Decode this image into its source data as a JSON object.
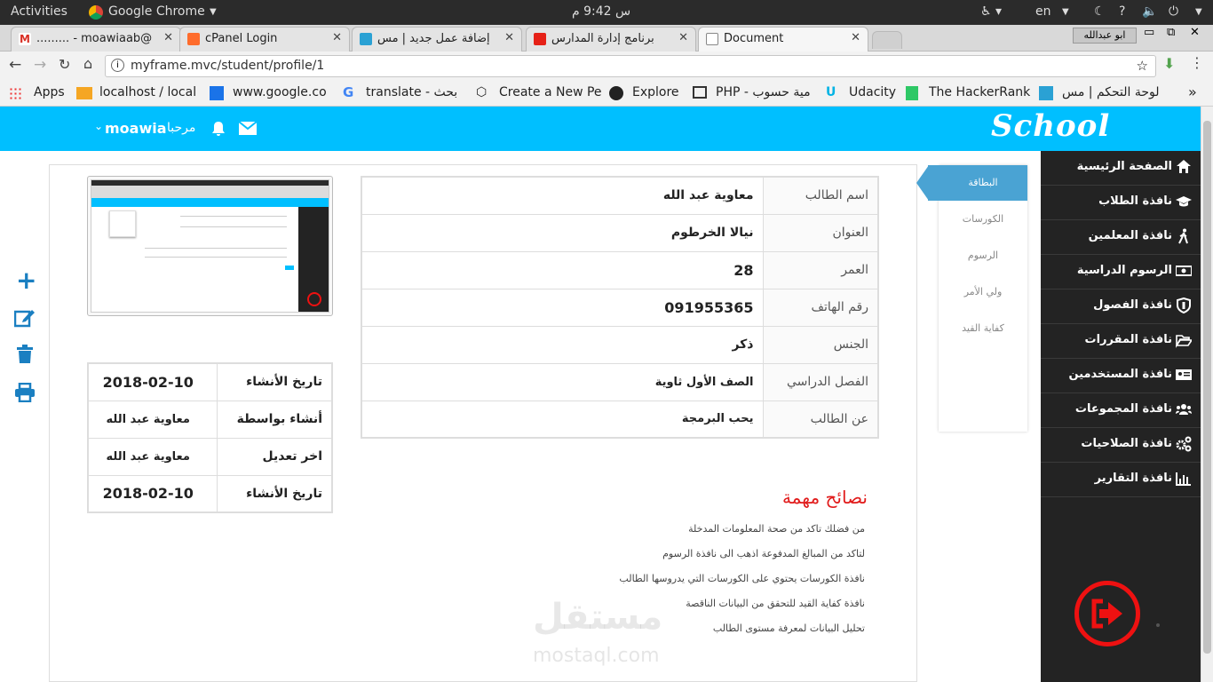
{
  "os": {
    "activities": "Activities",
    "app": "Google Chrome",
    "clock": "س 9:42 م",
    "lang": "en",
    "user_tag": "ابو عبدالله"
  },
  "tabs": [
    {
      "label": "......... - moawiaab@"
    },
    {
      "label": "cPanel Login"
    },
    {
      "label": "إضافة عمل جديد | مس"
    },
    {
      "label": "برنامج إدارة المدارس"
    },
    {
      "label": "Document"
    }
  ],
  "address": {
    "url": "myframe.mvc/student/profile/1"
  },
  "bookmarks": [
    {
      "label": "Apps"
    },
    {
      "label": "localhost / local"
    },
    {
      "label": "www.google.co"
    },
    {
      "label": "translate - بحث"
    },
    {
      "label": "Create a New Pe"
    },
    {
      "label": "Explore"
    },
    {
      "label": "PHP - مية حسوب"
    },
    {
      "label": "Udacity"
    },
    {
      "label": "The HackerRank"
    },
    {
      "label": "لوحة التحكم | مس"
    }
  ],
  "header": {
    "logo": "School",
    "greeting": "مرحبا",
    "username": "moawia"
  },
  "sidebar": {
    "items": [
      {
        "label": "الصفحة الرئيسية",
        "icon": "home-icon"
      },
      {
        "label": "نافذة الطلاب",
        "icon": "graduation-cap-icon"
      },
      {
        "label": "نافذة المعلمين",
        "icon": "walking-person-icon"
      },
      {
        "label": "الرسوم الدراسية",
        "icon": "money-icon"
      },
      {
        "label": "نافذة الفصول",
        "icon": "shield-icon"
      },
      {
        "label": "نافذة المقررات",
        "icon": "folder-open-icon"
      },
      {
        "label": "نافذة المستخدمين",
        "icon": "id-card-icon"
      },
      {
        "label": "نافذة المجموعات",
        "icon": "users-icon"
      },
      {
        "label": "نافذة الصلاحيات",
        "icon": "cogs-icon"
      },
      {
        "label": "نافذة التقارير",
        "icon": "bar-chart-icon"
      }
    ]
  },
  "profile_tabs": [
    {
      "label": "البطاقة"
    },
    {
      "label": "الكورسات"
    },
    {
      "label": "الرسوم"
    },
    {
      "label": "ولي الأمر"
    },
    {
      "label": "كفاية القيد"
    }
  ],
  "student": {
    "rows": [
      {
        "label": "اسم الطالب",
        "value": "معاوية عبد الله"
      },
      {
        "label": "العنوان",
        "value": "نيالا الخرطوم"
      },
      {
        "label": "العمر",
        "value": "28"
      },
      {
        "label": "رقم الهاتف",
        "value": "091955365"
      },
      {
        "label": "الجنس",
        "value": "ذكر"
      },
      {
        "label": "الفصل الدراسي",
        "value": "الصف الأول ثاوية"
      },
      {
        "label": "عن الطالب",
        "value": "يحب البرمجة"
      }
    ]
  },
  "meta": {
    "rows": [
      {
        "label": "تاريخ الأنشاء",
        "value": "2018-02-10"
      },
      {
        "label": "أنشاء بواسطة",
        "value": "معاوية عبد الله"
      },
      {
        "label": "اخر تعديل",
        "value": "معاوية عبد الله"
      },
      {
        "label": "تاريخ الأنشاء",
        "value": "2018-02-10"
      }
    ]
  },
  "tips": {
    "title": "نصائح مهمة",
    "items": [
      "من فضلك تاكد من صحة المعلومات المدخلة",
      "لتاكد من المبالغ المدفوعة اذهب الى نافذة الرسوم",
      "نافذة الكورسات يحتوي على الكورسات التي يدروسها الطالب",
      "نافذة كفاية القيد للتحقق من البيانات الناقصة",
      "تحليل البيانات لمعرفة مستوى الطالب"
    ]
  },
  "watermark": {
    "ar": "مستقل",
    "en": "mostaql.com"
  },
  "colors": {
    "header": "#00bfff",
    "sidebar": "#232323",
    "logout": "#ee1111",
    "tips_title": "#e11b1b",
    "accent": "#1a7fc1"
  }
}
